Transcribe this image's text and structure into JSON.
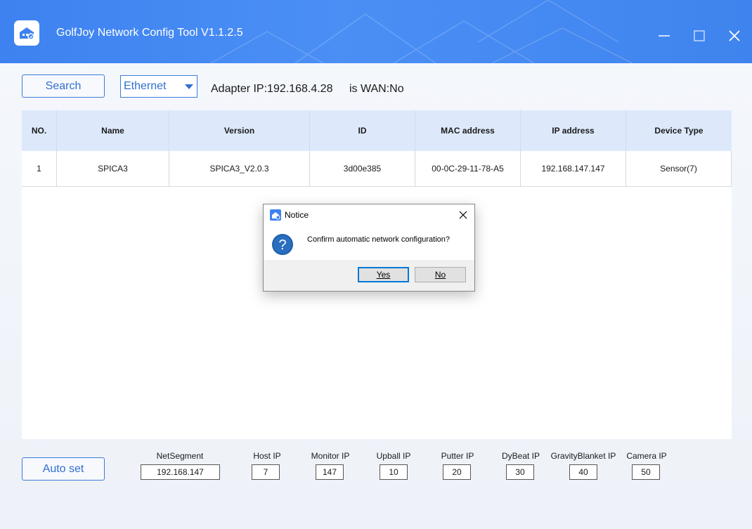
{
  "window": {
    "title": "GolfJoy Network Config Tool V1.1.2.5"
  },
  "toolbar": {
    "search_label": "Search",
    "adapter_select": "Ethernet",
    "adapter_ip": "Adapter IP:192.168.4.28",
    "is_wan": "is WAN:No"
  },
  "table": {
    "headers": [
      "NO.",
      "Name",
      "Version",
      "ID",
      "MAC address",
      "IP address",
      "Device Type"
    ],
    "rows": [
      [
        "1",
        "SPICA3",
        "SPICA3_V2.0.3",
        "3d00e385",
        "00-0C-29-11-78-A5",
        "192.168.147.147",
        "Sensor(7)"
      ]
    ]
  },
  "bottom": {
    "autoset_label": "Auto set",
    "fields": [
      {
        "label": "NetSegment",
        "value": "192.168.147"
      },
      {
        "label": "Host IP",
        "value": "7"
      },
      {
        "label": "Monitor IP",
        "value": "147"
      },
      {
        "label": "Upball IP",
        "value": "10"
      },
      {
        "label": "Putter IP",
        "value": "20"
      },
      {
        "label": "DyBeat IP",
        "value": "30"
      },
      {
        "label": "GravityBlanket IP",
        "value": "40"
      },
      {
        "label": "Camera IP",
        "value": "50"
      }
    ]
  },
  "dialog": {
    "title": "Notice",
    "message": "Confirm automatic network configuration?",
    "yes_label": "Yes",
    "no_label": "No"
  },
  "colors": {
    "accent": "#3a7bdc",
    "titlebar": "#4389f3",
    "table_header": "#dde9fb"
  }
}
